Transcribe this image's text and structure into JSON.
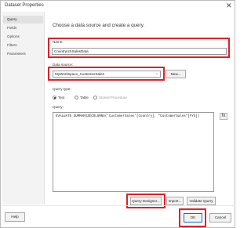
{
  "window": {
    "title": "Dataset Properties",
    "close_glyph": "✕"
  },
  "sidebar": {
    "items": [
      {
        "label": "Query",
        "selected": true
      },
      {
        "label": "Fields"
      },
      {
        "label": "Options"
      },
      {
        "label": "Filters"
      },
      {
        "label": "Parameters"
      }
    ]
  },
  "main": {
    "heading": "Choose a data source and create a query.",
    "name_label": "Name:",
    "name_value": "CountryUSSalesData",
    "datasource_label": "Data source:",
    "datasource_value": "MyWorkspace_CustomerSales",
    "new_button": "New...",
    "querytype_label": "Query type:",
    "querytype_options": [
      {
        "label": "Text",
        "selected": true,
        "enabled": true
      },
      {
        "label": "Table",
        "selected": false,
        "enabled": true
      },
      {
        "label": "Stored Procedure",
        "selected": false,
        "enabled": false
      }
    ],
    "query_label": "Query:",
    "query_text": "EVALUATE SUMMARIZECOLUMNS('CustomerSales'[Country], \"CustomerSales\"[FYS])",
    "fx_icon": "fx"
  },
  "buttons": {
    "query_designer": "Query Designer...",
    "import": "Import...",
    "validate_query": "Validate Query",
    "help": "Help",
    "ok": "OK",
    "cancel": "Cancel"
  },
  "colors": {
    "highlight": "#e0202a",
    "accent": "#0a6ed1"
  }
}
